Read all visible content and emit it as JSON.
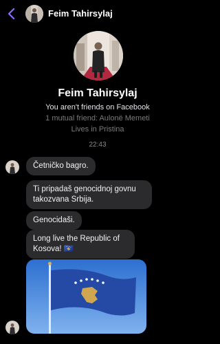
{
  "header": {
    "back_icon": "chevron-left-icon",
    "name": "Feim Tahirsylaj",
    "accent": "#8f6cff"
  },
  "profile": {
    "name": "Feim Tahirsylaj",
    "friend_status": "You aren't friends on Facebook",
    "mutual": "1 mutual friend: Aulonë Memeti",
    "location": "Lives in Pristina"
  },
  "timestamp": "22:43",
  "messages": [
    {
      "text": "Četničko bagro."
    },
    {
      "text": "Ti pripadaš genocidnoj govnu takozvana Srbija."
    },
    {
      "text": "Genocidaši."
    },
    {
      "text": "Long live the Republic of Kosova! 🇽🇰"
    }
  ],
  "colors": {
    "bubble": "#2b2b2d",
    "flag_blue": "#244aa5",
    "flag_gold": "#d0a650"
  }
}
